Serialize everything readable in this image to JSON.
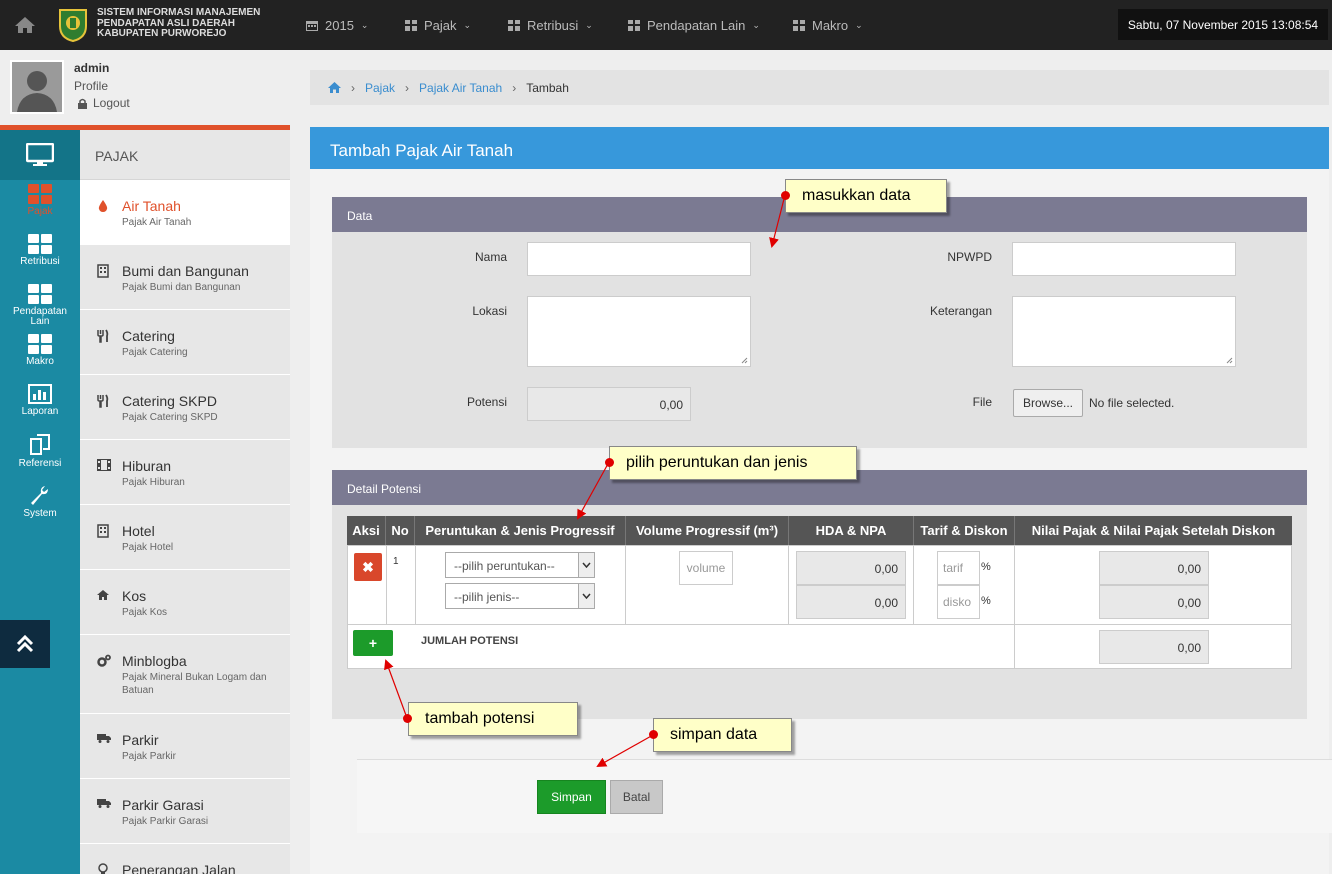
{
  "header": {
    "title_lines": [
      "SISTEM INFORMASI MANAJEMEN",
      "PENDAPATAN ASLI DAERAH",
      "KABUPATEN PURWOREJO"
    ],
    "nav": [
      {
        "label": "2015",
        "icon": "calendar-icon"
      },
      {
        "label": "Pajak",
        "icon": "grid-icon"
      },
      {
        "label": "Retribusi",
        "icon": "grid-icon"
      },
      {
        "label": "Pendapatan Lain",
        "icon": "grid-icon"
      },
      {
        "label": "Makro",
        "icon": "grid-icon"
      }
    ],
    "datetime": "Sabtu, 07 November 2015  13:08:54"
  },
  "user": {
    "name": "admin",
    "profile": "Profile",
    "logout": "Logout"
  },
  "icon_bar": [
    {
      "label": "Pajak",
      "icon": "grid-icon",
      "active": true
    },
    {
      "label": "Retribusi",
      "icon": "grid-icon"
    },
    {
      "label": "Pendapatan Lain",
      "icon": "grid-icon"
    },
    {
      "label": "Makro",
      "icon": "grid-icon"
    },
    {
      "label": "Laporan",
      "icon": "chart-icon"
    },
    {
      "label": "Referensi",
      "icon": "copy-icon"
    },
    {
      "label": "System",
      "icon": "wrench-icon"
    }
  ],
  "menu": {
    "heading": "PAJAK",
    "items": [
      {
        "title": "Air Tanah",
        "sub": "Pajak Air Tanah",
        "icon": "drop-icon",
        "active": true
      },
      {
        "title": "Bumi dan Bangunan",
        "sub": "Pajak Bumi dan Bangunan",
        "icon": "building-icon"
      },
      {
        "title": "Catering",
        "sub": "Pajak Catering",
        "icon": "cutlery-icon"
      },
      {
        "title": "Catering SKPD",
        "sub": "Pajak Catering SKPD",
        "icon": "cutlery-icon"
      },
      {
        "title": "Hiburan",
        "sub": "Pajak Hiburan",
        "icon": "film-icon"
      },
      {
        "title": "Hotel",
        "sub": "Pajak Hotel",
        "icon": "building-icon"
      },
      {
        "title": "Kos",
        "sub": "Pajak Kos",
        "icon": "home-icon"
      },
      {
        "title": "Minblogba",
        "sub": "Pajak Mineral Bukan Logam dan Batuan",
        "icon": "gears-icon"
      },
      {
        "title": "Parkir",
        "sub": "Pajak Parkir",
        "icon": "truck-icon"
      },
      {
        "title": "Parkir Garasi",
        "sub": "Pajak Parkir Garasi",
        "icon": "truck-icon"
      },
      {
        "title": "Penerangan Jalan",
        "sub": "",
        "icon": "bulb-icon"
      }
    ]
  },
  "breadcrumb": {
    "items": [
      "Pajak",
      "Pajak Air Tanah"
    ],
    "current": "Tambah"
  },
  "form": {
    "title": "Tambah Pajak Air Tanah",
    "data_section": "Data",
    "labels": {
      "nama": "Nama",
      "npwpd": "NPWPD",
      "lokasi": "Lokasi",
      "keterangan": "Keterangan",
      "potensi": "Potensi",
      "file": "File"
    },
    "potensi_value": "0,00",
    "browse_label": "Browse...",
    "file_status": "No file selected.",
    "detail_section": "Detail Potensi",
    "table_headers": [
      "Aksi",
      "No",
      "Peruntukan & Jenis Progressif",
      "Volume Progressif (m³)",
      "HDA & NPA",
      "Tarif & Diskon",
      "Nilai Pajak & Nilai Pajak Setelah Diskon"
    ],
    "row": {
      "no": "1",
      "peruntukan_placeholder": "--pilih peruntukan--",
      "jenis_placeholder": "--pilih jenis--",
      "volume_placeholder": "volume",
      "hda": "0,00",
      "npa": "0,00",
      "tarif_placeholder": "tarif",
      "diskon_placeholder": "disko",
      "pct": "%",
      "nilai": "0,00",
      "nilai_diskon": "0,00"
    },
    "jumlah_label": "JUMLAH POTENSI",
    "jumlah_value": "0,00",
    "save_label": "Simpan",
    "cancel_label": "Batal"
  },
  "callouts": {
    "masukkan": "masukkan data",
    "pilih": "pilih peruntukan dan jenis",
    "tambah": "tambah potensi",
    "simpan": "simpan data"
  },
  "colors": {
    "accent": "#e0512b",
    "blue": "#3798db",
    "teal": "#1b8aa3",
    "green": "#1c9b2a"
  }
}
